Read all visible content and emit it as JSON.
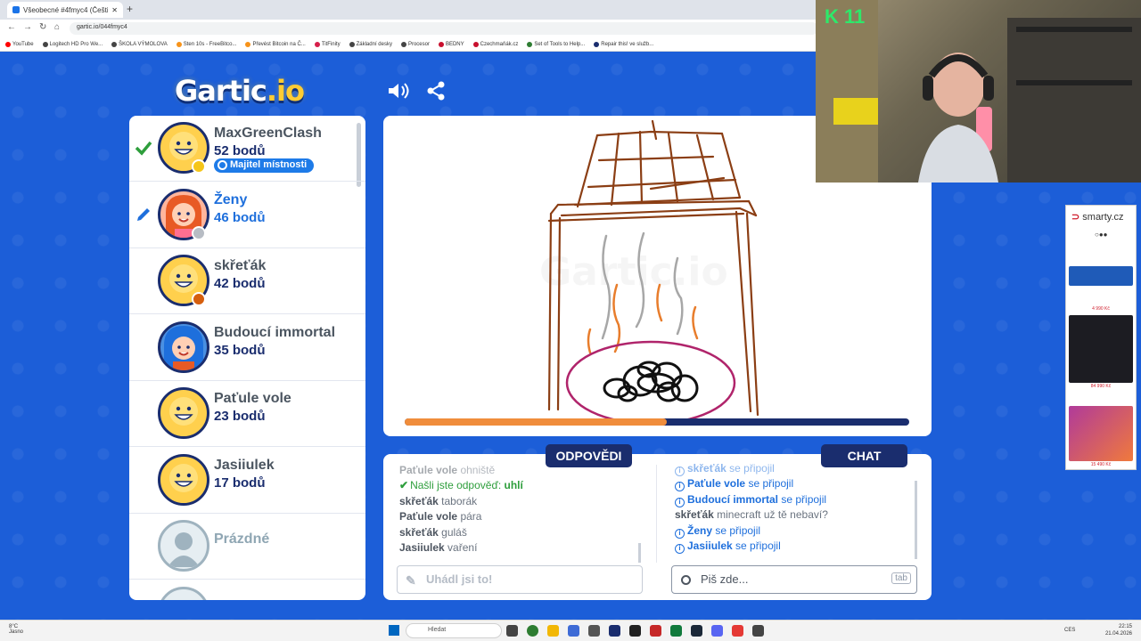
{
  "browser": {
    "tab_title": "Všeobecné #4fmyc4 (Čeština)",
    "new_tab": "+",
    "url": "gartic.io/044fmyc4",
    "bookmarks": [
      {
        "label": "YouTube",
        "color": "#ff0000"
      },
      {
        "label": "Logitech HD Pro We...",
        "color": "#444"
      },
      {
        "label": "ŠKOLA VÝMOLOVA",
        "color": "#444"
      },
      {
        "label": "Sten 10s - FreeBitco...",
        "color": "#f7931a"
      },
      {
        "label": "Převést Bitcoin na Č...",
        "color": "#f7931a"
      },
      {
        "label": "TitFinity",
        "color": "#d61f4b"
      },
      {
        "label": "Základní desky",
        "color": "#444"
      },
      {
        "label": "Procesor",
        "color": "#444"
      },
      {
        "label": "BEDNY",
        "color": "#c8102e"
      },
      {
        "label": "Czechmaňák.cz",
        "color": "#c8102e"
      },
      {
        "label": "Set of Tools to Help...",
        "color": "#2e7d32"
      },
      {
        "label": "Repair this! ve služb...",
        "color": "#1a2d6e"
      }
    ]
  },
  "game": {
    "logo_main": "Gartic",
    "logo_suffix": ".io",
    "watermark": "Gartic.io",
    "timer_fraction": 0.52,
    "owner_badge": "Majitel místnosti",
    "players": [
      {
        "name": "MaxGreenClash",
        "points": "52 bodů",
        "avatar": "smiley",
        "marker": "check",
        "dot": "#f5c518",
        "owner": true
      },
      {
        "name": "Ženy",
        "points": "46 bodů",
        "avatar": "girl",
        "marker": "pencil",
        "dot": "#b7bcc4",
        "owner": false,
        "highlight": true
      },
      {
        "name": "skřeťák",
        "points": "42 bodů",
        "avatar": "smiley",
        "marker": "",
        "dot": "#d65f0e",
        "owner": false
      },
      {
        "name": "Budoucí immortal",
        "points": "35 bodů",
        "avatar": "blue",
        "marker": "",
        "dot": "",
        "owner": false
      },
      {
        "name": "Paťule vole",
        "points": "23 bodů",
        "avatar": "smiley",
        "marker": "",
        "dot": "",
        "owner": false
      },
      {
        "name": "Jasiiulek",
        "points": "17 bodů",
        "avatar": "smiley",
        "marker": "",
        "dot": "",
        "owner": false
      },
      {
        "name": "Prázdné",
        "points": "",
        "avatar": "empty",
        "marker": "",
        "dot": "",
        "owner": false
      }
    ],
    "tabs": {
      "answers": "ODPOVĚDI",
      "chat": "CHAT"
    },
    "answers": {
      "faded_user": "Paťule vole",
      "faded_text": "ohniště",
      "correct_text": "Našli jste odpověď:",
      "correct_word": "uhlí",
      "lines": [
        {
          "user": "skřeťák",
          "text": "taborák"
        },
        {
          "user": "Paťule vole",
          "text": "pára"
        },
        {
          "user": "skřeťák",
          "text": "guláš"
        },
        {
          "user": "Jasiiulek",
          "text": "vaření"
        }
      ],
      "input_placeholder": "Uhádl jsi to!"
    },
    "chat": {
      "faded_user": "skřeťák",
      "faded_text": "se připojil",
      "joined": "se připojil",
      "join_users": [
        "Paťule vole",
        "Budoucí immortal"
      ],
      "message_user": "skřeťák",
      "message_text": "minecraft už tě nebaví?",
      "join_users_after": [
        "Ženy",
        "Jasiiulek"
      ],
      "input_placeholder": "Piš zde...",
      "tab_key": "tab"
    }
  },
  "webcam": {
    "logo": "K 11"
  },
  "ad": {
    "brand_prefix": "",
    "brand": "smarty.cz",
    "prices": [
      "4 990 Kč",
      "84 990 Kč",
      "15 490 Kč"
    ]
  },
  "taskbar": {
    "weather_temp": "8°C",
    "weather_desc": "Jasno",
    "search": "Hledat",
    "lang": "CES",
    "time": "22:15",
    "date": "21.04.2026"
  },
  "colors": {
    "background": "#1c5ed8",
    "navy": "#1a2d6e",
    "timer_orange": "#f08d3c",
    "sys_blue": "#1e6fdc",
    "correct_green": "#2e9e3c"
  }
}
